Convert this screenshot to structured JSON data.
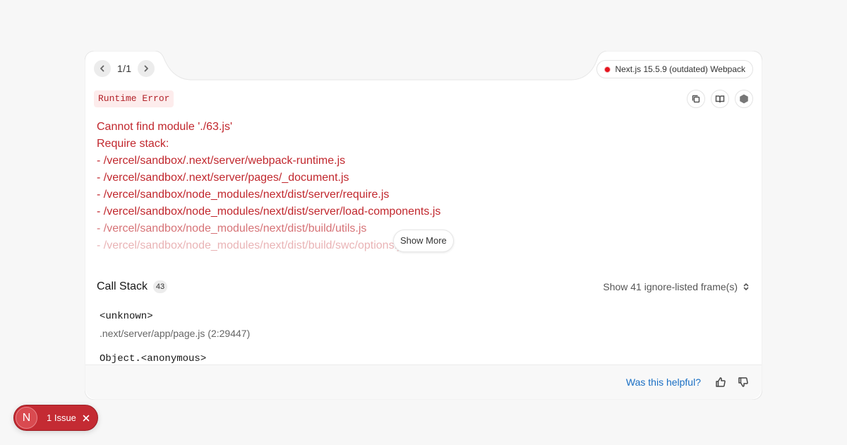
{
  "pager": {
    "text": "1/1"
  },
  "version": {
    "label": "Next.js 15.5.9 (outdated) Webpack",
    "dot_color": "#e5141d"
  },
  "error": {
    "type": "Runtime Error",
    "lines": [
      "Cannot find module './63.js'",
      "Require stack:",
      "- /vercel/sandbox/.next/server/webpack-runtime.js",
      "- /vercel/sandbox/.next/server/pages/_document.js",
      "- /vercel/sandbox/node_modules/next/dist/server/require.js",
      "- /vercel/sandbox/node_modules/next/dist/server/load-components.js",
      "- /vercel/sandbox/node_modules/next/dist/build/utils.js",
      "- /vercel/sandbox/node_modules/next/dist/build/swc/options.js"
    ],
    "show_more": "Show More"
  },
  "call_stack": {
    "title": "Call Stack",
    "count": "43",
    "ignore_label": "Show 41 ignore-listed frame(s)",
    "frames": [
      {
        "fn": "<unknown>",
        "file": ".next/server/app/page.js (2:29447)"
      },
      {
        "fn": "Object.<anonymous>",
        "file": ""
      }
    ]
  },
  "footer": {
    "helpful": "Was this helpful?"
  },
  "issue_pill": {
    "logo": "N",
    "label": "1 Issue"
  },
  "colors": {
    "error_red": "#c1272d",
    "link_blue": "#1a6fc4",
    "pill_red": "#c42b33"
  }
}
